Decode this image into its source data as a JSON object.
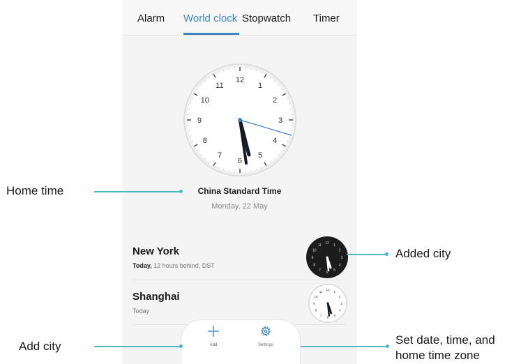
{
  "tabs": [
    {
      "label": "Alarm"
    },
    {
      "label": "World clock"
    },
    {
      "label": "Stopwatch"
    },
    {
      "label": "Timer"
    }
  ],
  "home_clock": {
    "numbers": [
      "12",
      "1",
      "2",
      "3",
      "4",
      "5",
      "6",
      "7",
      "8",
      "9",
      "10",
      "11"
    ],
    "timezone": "China Standard Time",
    "date": "Monday, 22 May"
  },
  "cities": [
    {
      "name": "New York",
      "sub_bold": "Today,",
      "sub_rest": " 12 hours behind, DST",
      "clock_style": "dark"
    },
    {
      "name": "Shanghai",
      "sub_bold": "",
      "sub_rest": "Today",
      "clock_style": "light"
    }
  ],
  "bottom_bar": {
    "add_label": "Add",
    "settings_label": "Settings"
  },
  "callouts": {
    "home_time": "Home time",
    "added_city": "Added city",
    "add_city": "Add city",
    "set_date_1": "Set date, time, and",
    "set_date_2": "home time zone"
  },
  "colors": {
    "accent": "#3d86c6",
    "callout_line": "#4bb8c4",
    "second_hand": "#3d86c6"
  }
}
